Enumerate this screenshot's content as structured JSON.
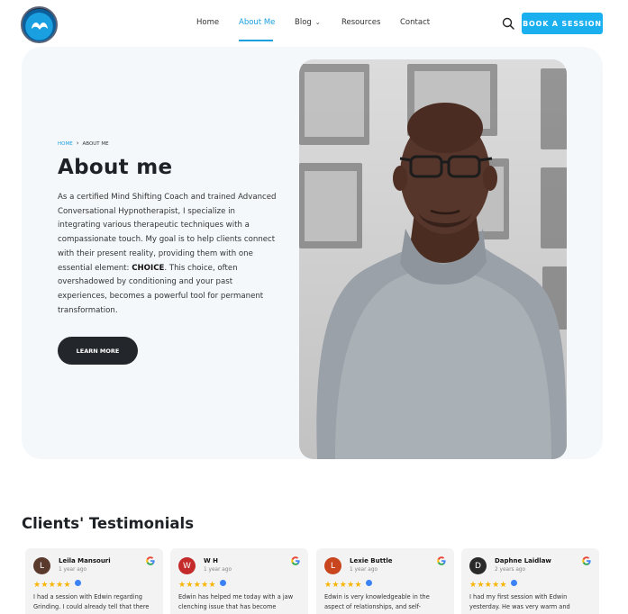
{
  "nav": {
    "items": [
      "Home",
      "About Me",
      "Blog",
      "Resources",
      "Contact"
    ],
    "active": "About Me",
    "book_label": "BOOK A SESSION"
  },
  "breadcrumb": {
    "home": "HOME",
    "current": "ABOUT ME"
  },
  "hero": {
    "title": "About me",
    "para_before": "As a certified Mind Shifting Coach and trained Advanced Conversational Hypnotherapist, I specialize in integrating various therapeutic techniques with a compassionate touch. My goal is to help clients connect with their present reality, providing them with one essential element: ",
    "para_bold": "CHOICE",
    "para_after": ". This choice, often overshadowed by conditioning and your past experiences, becomes a powerful tool for permanent transformation.",
    "button": "LEARN MORE"
  },
  "testimonials": {
    "title": "Clients' Testimonials",
    "reviews": [
      {
        "initial": "L",
        "name": "Leila Mansouri",
        "time": "1 year ago",
        "stars": "★★★★★",
        "text": "I had a session with Edwin regarding Grinding. I could already tell that there",
        "avatar_color": "#5b3a2e"
      },
      {
        "initial": "W",
        "name": "W H",
        "time": "1 year ago",
        "stars": "★★★★★",
        "text": "Edwin has helped me today with a jaw clenching issue that has become",
        "avatar_color": "#c42a2a"
      },
      {
        "initial": "L",
        "name": "Lexie Buttle",
        "time": "1 year ago",
        "stars": "★★★★★",
        "text": "Edwin is very knowledgeable in the aspect of relationships, and self-",
        "avatar_color": "#c9451d"
      },
      {
        "initial": "D",
        "name": "Daphne Laidlaw",
        "time": "2 years ago",
        "stars": "★★★★★",
        "text": "I had my first session with Edwin yesterday. He was very warm and",
        "avatar_color": "#2a2a2a"
      }
    ]
  }
}
